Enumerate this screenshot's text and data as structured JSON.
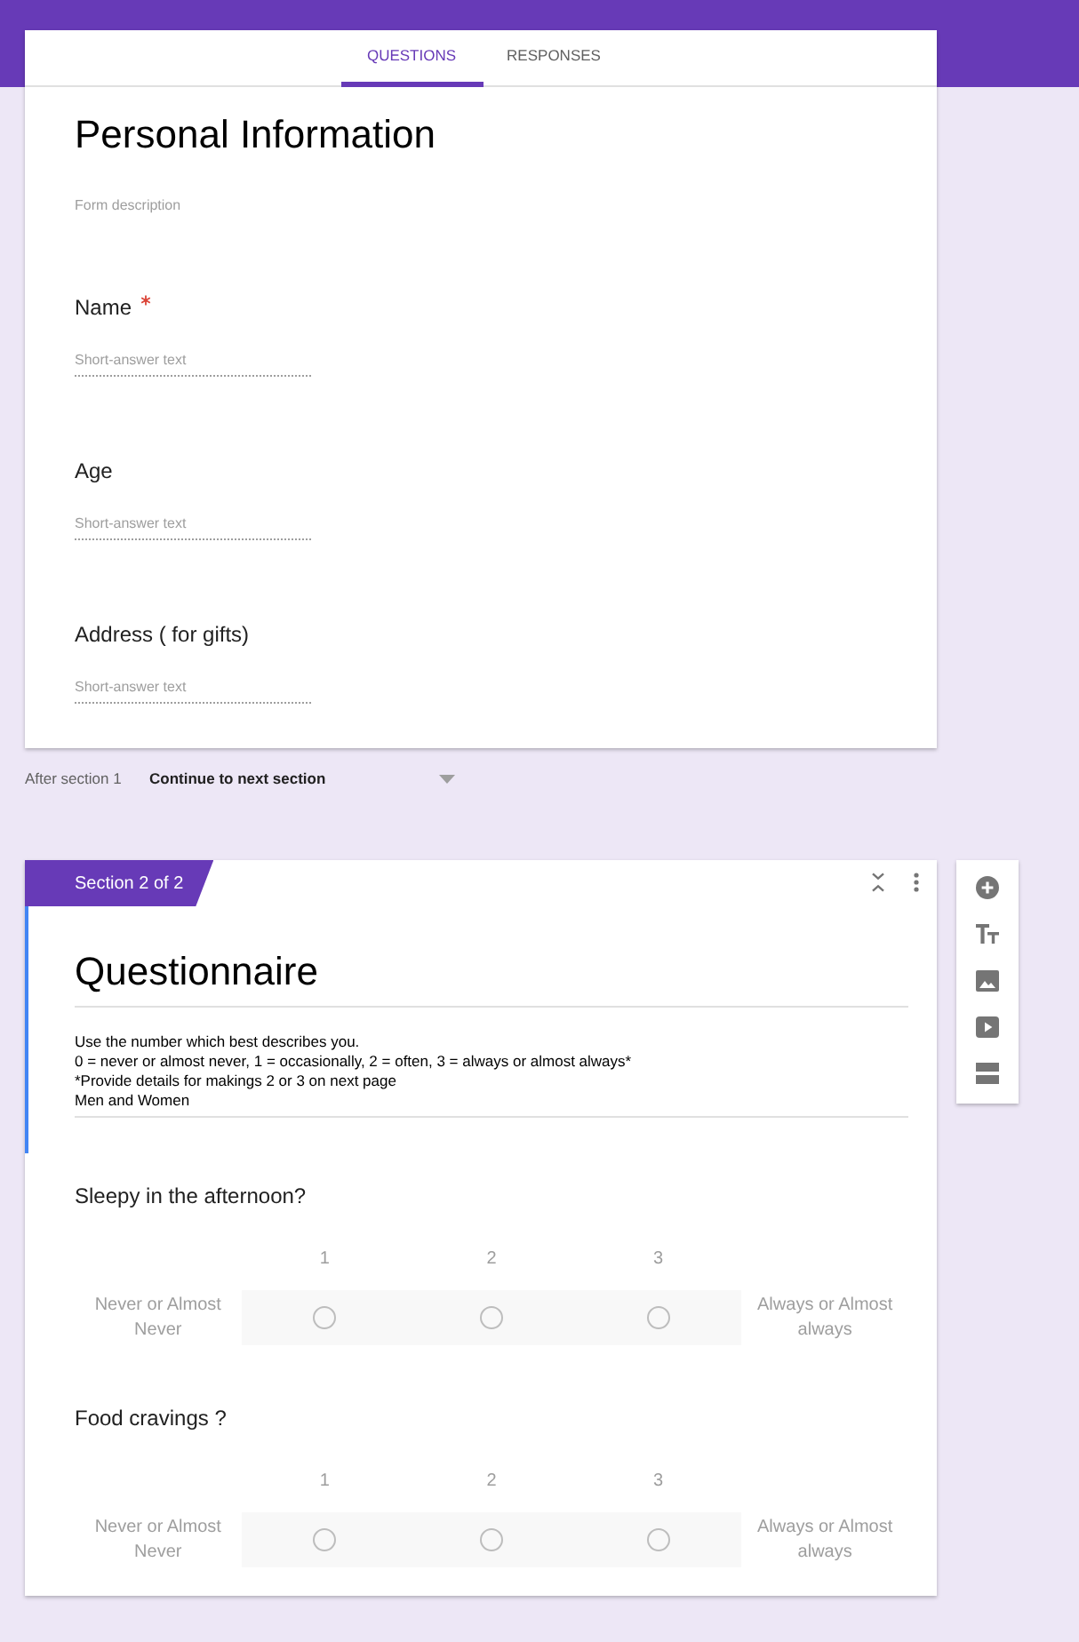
{
  "header": {
    "tabs": [
      {
        "label": "QUESTIONS",
        "selected": true
      },
      {
        "label": "RESPONSES",
        "selected": false
      }
    ]
  },
  "section_1": {
    "title": "Personal Information",
    "description": {
      "placeholder": "Form description"
    },
    "questions": [
      {
        "label": "Name",
        "required": true,
        "placeholder": "Short-answer text"
      },
      {
        "label": "Age",
        "required": false,
        "placeholder": "Short-answer text"
      },
      {
        "label": "Address ( for gifts)",
        "required": false,
        "placeholder": "Short-answer text"
      }
    ]
  },
  "after_section": {
    "label": "After section 1",
    "value": "Continue to next section"
  },
  "section_2": {
    "badge": "Section 2 of 2",
    "focused": true,
    "title": "Questionnaire",
    "description": [
      "Use the number which best describes you.",
      "0 = never or almost never, 1 = occasionally, 2 = often, 3 = always or almost always*",
      "*Provide details for makings 2 or 3 on next page",
      "Men and Women"
    ],
    "questions": [
      {
        "label": "Sleepy in the afternoon?",
        "low_label": "Never or Almost Never",
        "high_label": "Always or Almost always",
        "options": [
          {
            "label": "1",
            "selected": false
          },
          {
            "label": "2",
            "selected": false
          },
          {
            "label": "3",
            "selected": false
          }
        ]
      },
      {
        "label": "Food cravings ?",
        "low_label": "Never or Almost Never",
        "high_label": "Always or Almost always",
        "options": [
          {
            "label": "1",
            "selected": false
          },
          {
            "label": "2",
            "selected": false
          },
          {
            "label": "3",
            "selected": false
          }
        ]
      }
    ]
  }
}
